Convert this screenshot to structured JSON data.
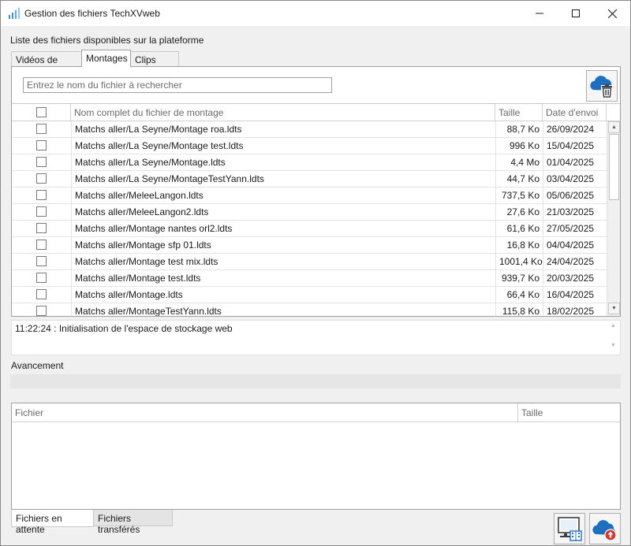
{
  "window": {
    "title": "Gestion des fichiers TechXVweb"
  },
  "labels": {
    "available_files": "Liste des fichiers disponibles sur la plateforme",
    "progress": "Avancement"
  },
  "tabs": [
    {
      "label": "Vidéos de match",
      "active": false
    },
    {
      "label": "Montages",
      "active": true
    },
    {
      "label": "Clips vidéo",
      "active": false
    }
  ],
  "search": {
    "placeholder": "Entrez le nom du fichier à rechercher",
    "value": ""
  },
  "table": {
    "columns": {
      "name": "Nom complet du fichier de montage",
      "size": "Taille",
      "date": "Date d'envoi"
    },
    "rows": [
      {
        "name": "Matchs aller/La Seyne/Montage roa.ldts",
        "size": "88,7 Ko",
        "date": "26/09/2024"
      },
      {
        "name": "Matchs aller/La Seyne/Montage test.ldts",
        "size": "996 Ko",
        "date": "15/04/2025"
      },
      {
        "name": "Matchs aller/La Seyne/Montage.ldts",
        "size": "4,4 Mo",
        "date": "01/04/2025"
      },
      {
        "name": "Matchs aller/La Seyne/MontageTestYann.ldts",
        "size": "44,7 Ko",
        "date": "03/04/2025"
      },
      {
        "name": "Matchs aller/MeleeLangon.ldts",
        "size": "737,5 Ko",
        "date": "05/06/2025"
      },
      {
        "name": "Matchs aller/MeleeLangon2.ldts",
        "size": "27,6 Ko",
        "date": "21/03/2025"
      },
      {
        "name": "Matchs aller/Montage nantes orl2.ldts",
        "size": "61,6 Ko",
        "date": "27/05/2025"
      },
      {
        "name": "Matchs aller/Montage sfp 01.ldts",
        "size": "16,8 Ko",
        "date": "04/04/2025"
      },
      {
        "name": "Matchs aller/Montage test mix.ldts",
        "size": "1001,4 Ko",
        "date": "24/04/2025"
      },
      {
        "name": "Matchs aller/Montage test.ldts",
        "size": "939,7 Ko",
        "date": "20/03/2025"
      },
      {
        "name": "Matchs aller/Montage.ldts",
        "size": "66,4 Ko",
        "date": "16/04/2025"
      },
      {
        "name": "Matchs aller/MontageTestYann.ldts",
        "size": "115,8 Ko",
        "date": "18/02/2025"
      }
    ]
  },
  "log": {
    "text": "11:22:24 : Initialisation de l'espace de stockage web"
  },
  "progress": {
    "fraction": 0
  },
  "transfer": {
    "columns": {
      "file": "Fichier",
      "size": "Taille"
    }
  },
  "bottom_tabs": [
    {
      "label": "Fichiers en attente",
      "active": true
    },
    {
      "label": "Fichiers transférés",
      "active": false
    }
  ],
  "icons": {
    "app": "bar-chart-icon",
    "cloud_delete": "cloud-delete-icon",
    "media_transfer": "monitor-film-icon",
    "cloud_upload": "cloud-upload-icon"
  },
  "colors": {
    "cloud_blue": "#1f6fc1",
    "upload_red": "#d9342b",
    "app_icon_blue": "#3a8fd6"
  }
}
